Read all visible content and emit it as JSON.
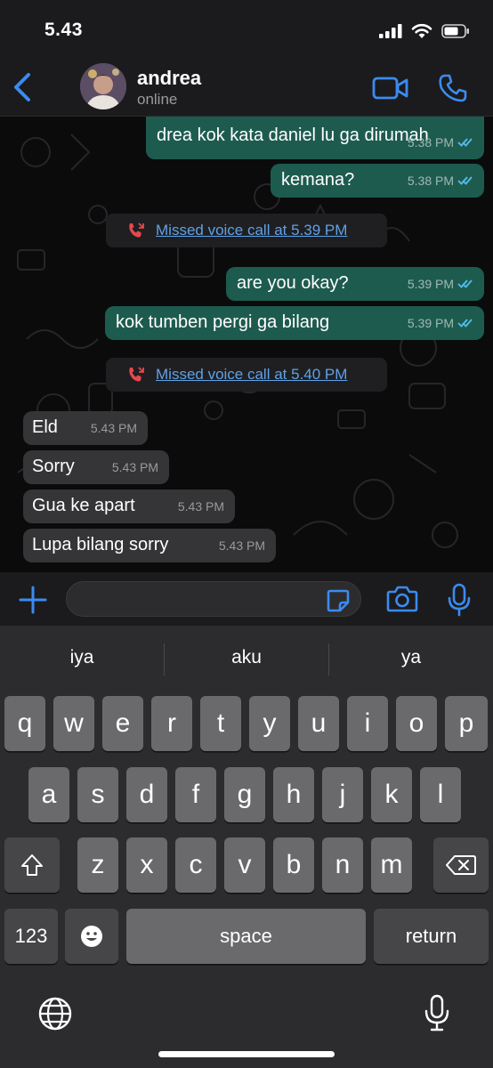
{
  "status_bar": {
    "time": "5.43"
  },
  "header": {
    "contact_name": "andrea",
    "contact_status": "online"
  },
  "messages": [
    {
      "text": "drea kok kata daniel lu ga dirumah",
      "time": "5.38 PM",
      "direction": "out"
    },
    {
      "text": "kemana?",
      "time": "5.38 PM",
      "direction": "out"
    },
    {
      "text": "are you okay?",
      "time": "5.39 PM",
      "direction": "out"
    },
    {
      "text": "kok tumben pergi ga bilang",
      "time": "5.39 PM",
      "direction": "out"
    },
    {
      "text": "Eld",
      "time": "5.43 PM",
      "direction": "in"
    },
    {
      "text": "Sorry",
      "time": "5.43 PM",
      "direction": "in"
    },
    {
      "text": "Gua ke apart",
      "time": "5.43 PM",
      "direction": "in"
    },
    {
      "text": "Lupa bilang sorry",
      "time": "5.43 PM",
      "direction": "in"
    }
  ],
  "system_messages": [
    {
      "text": "Missed voice call at 5.39 PM",
      "icon": "missed-call-icon"
    },
    {
      "text": "Missed voice call at 5.40 PM",
      "icon": "missed-call-icon"
    }
  ],
  "input": {
    "placeholder": ""
  },
  "keyboard": {
    "suggestions": [
      "iya",
      "aku",
      "ya"
    ],
    "row1": [
      "q",
      "w",
      "e",
      "r",
      "t",
      "y",
      "u",
      "i",
      "o",
      "p"
    ],
    "row2": [
      "a",
      "s",
      "d",
      "f",
      "g",
      "h",
      "j",
      "k",
      "l"
    ],
    "row3": [
      "z",
      "x",
      "c",
      "v",
      "b",
      "n",
      "m"
    ],
    "numbers_key": "123",
    "space_key": "space",
    "return_key": "return"
  },
  "colors": {
    "accent_blue": "#3b8bf0",
    "outgoing_bubble": "#1e5b4f",
    "incoming_bubble": "#353537",
    "missed_call_red": "#e5484d",
    "read_ticks": "#53bdeb"
  }
}
